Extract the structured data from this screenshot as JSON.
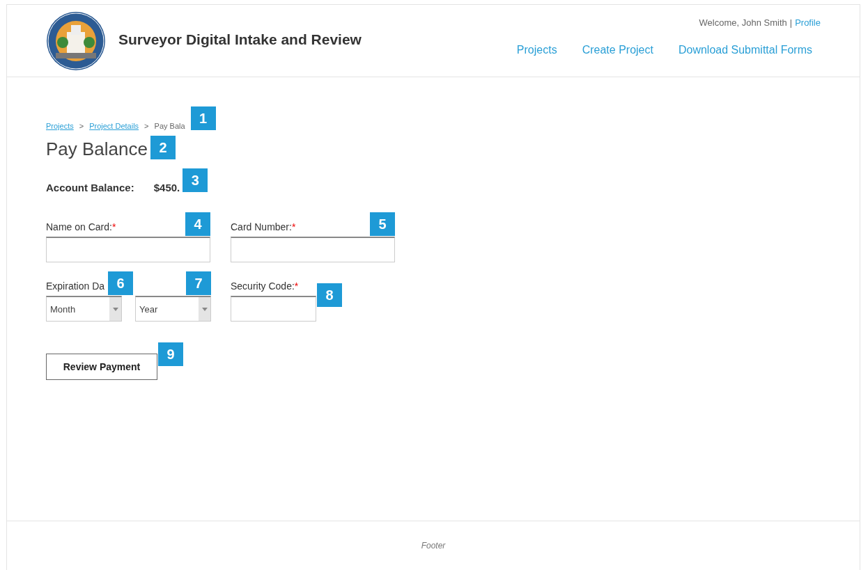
{
  "header": {
    "title": "Surveyor Digital Intake and Review",
    "welcome": "Welcome, John Smith",
    "separator": "|",
    "profile_link": "Profile",
    "nav": [
      "Projects",
      "Create Project",
      "Download Submittal Forms"
    ]
  },
  "breadcrumb": {
    "links": [
      "Projects",
      "Project Details"
    ],
    "separator": ">",
    "current": "Pay Bala"
  },
  "page_title": "Pay Balance",
  "balance": {
    "label": "Account Balance:",
    "value": "$450."
  },
  "fields": [
    {
      "kind": "text",
      "label": "Name on Card:",
      "marker": "*"
    },
    {
      "kind": "text",
      "label": "Card Number:",
      "marker": "*"
    },
    {
      "kind": "expiry",
      "label": "Expiration Da",
      "selects": [
        "Month",
        "Year"
      ]
    },
    {
      "kind": "code",
      "label": "Security Code:",
      "marker": "*"
    }
  ],
  "button": "Review Payment",
  "callouts": [
    "1",
    "2",
    "3",
    "4",
    "5",
    "6",
    "7",
    "8",
    "9"
  ],
  "footer": "Footer"
}
